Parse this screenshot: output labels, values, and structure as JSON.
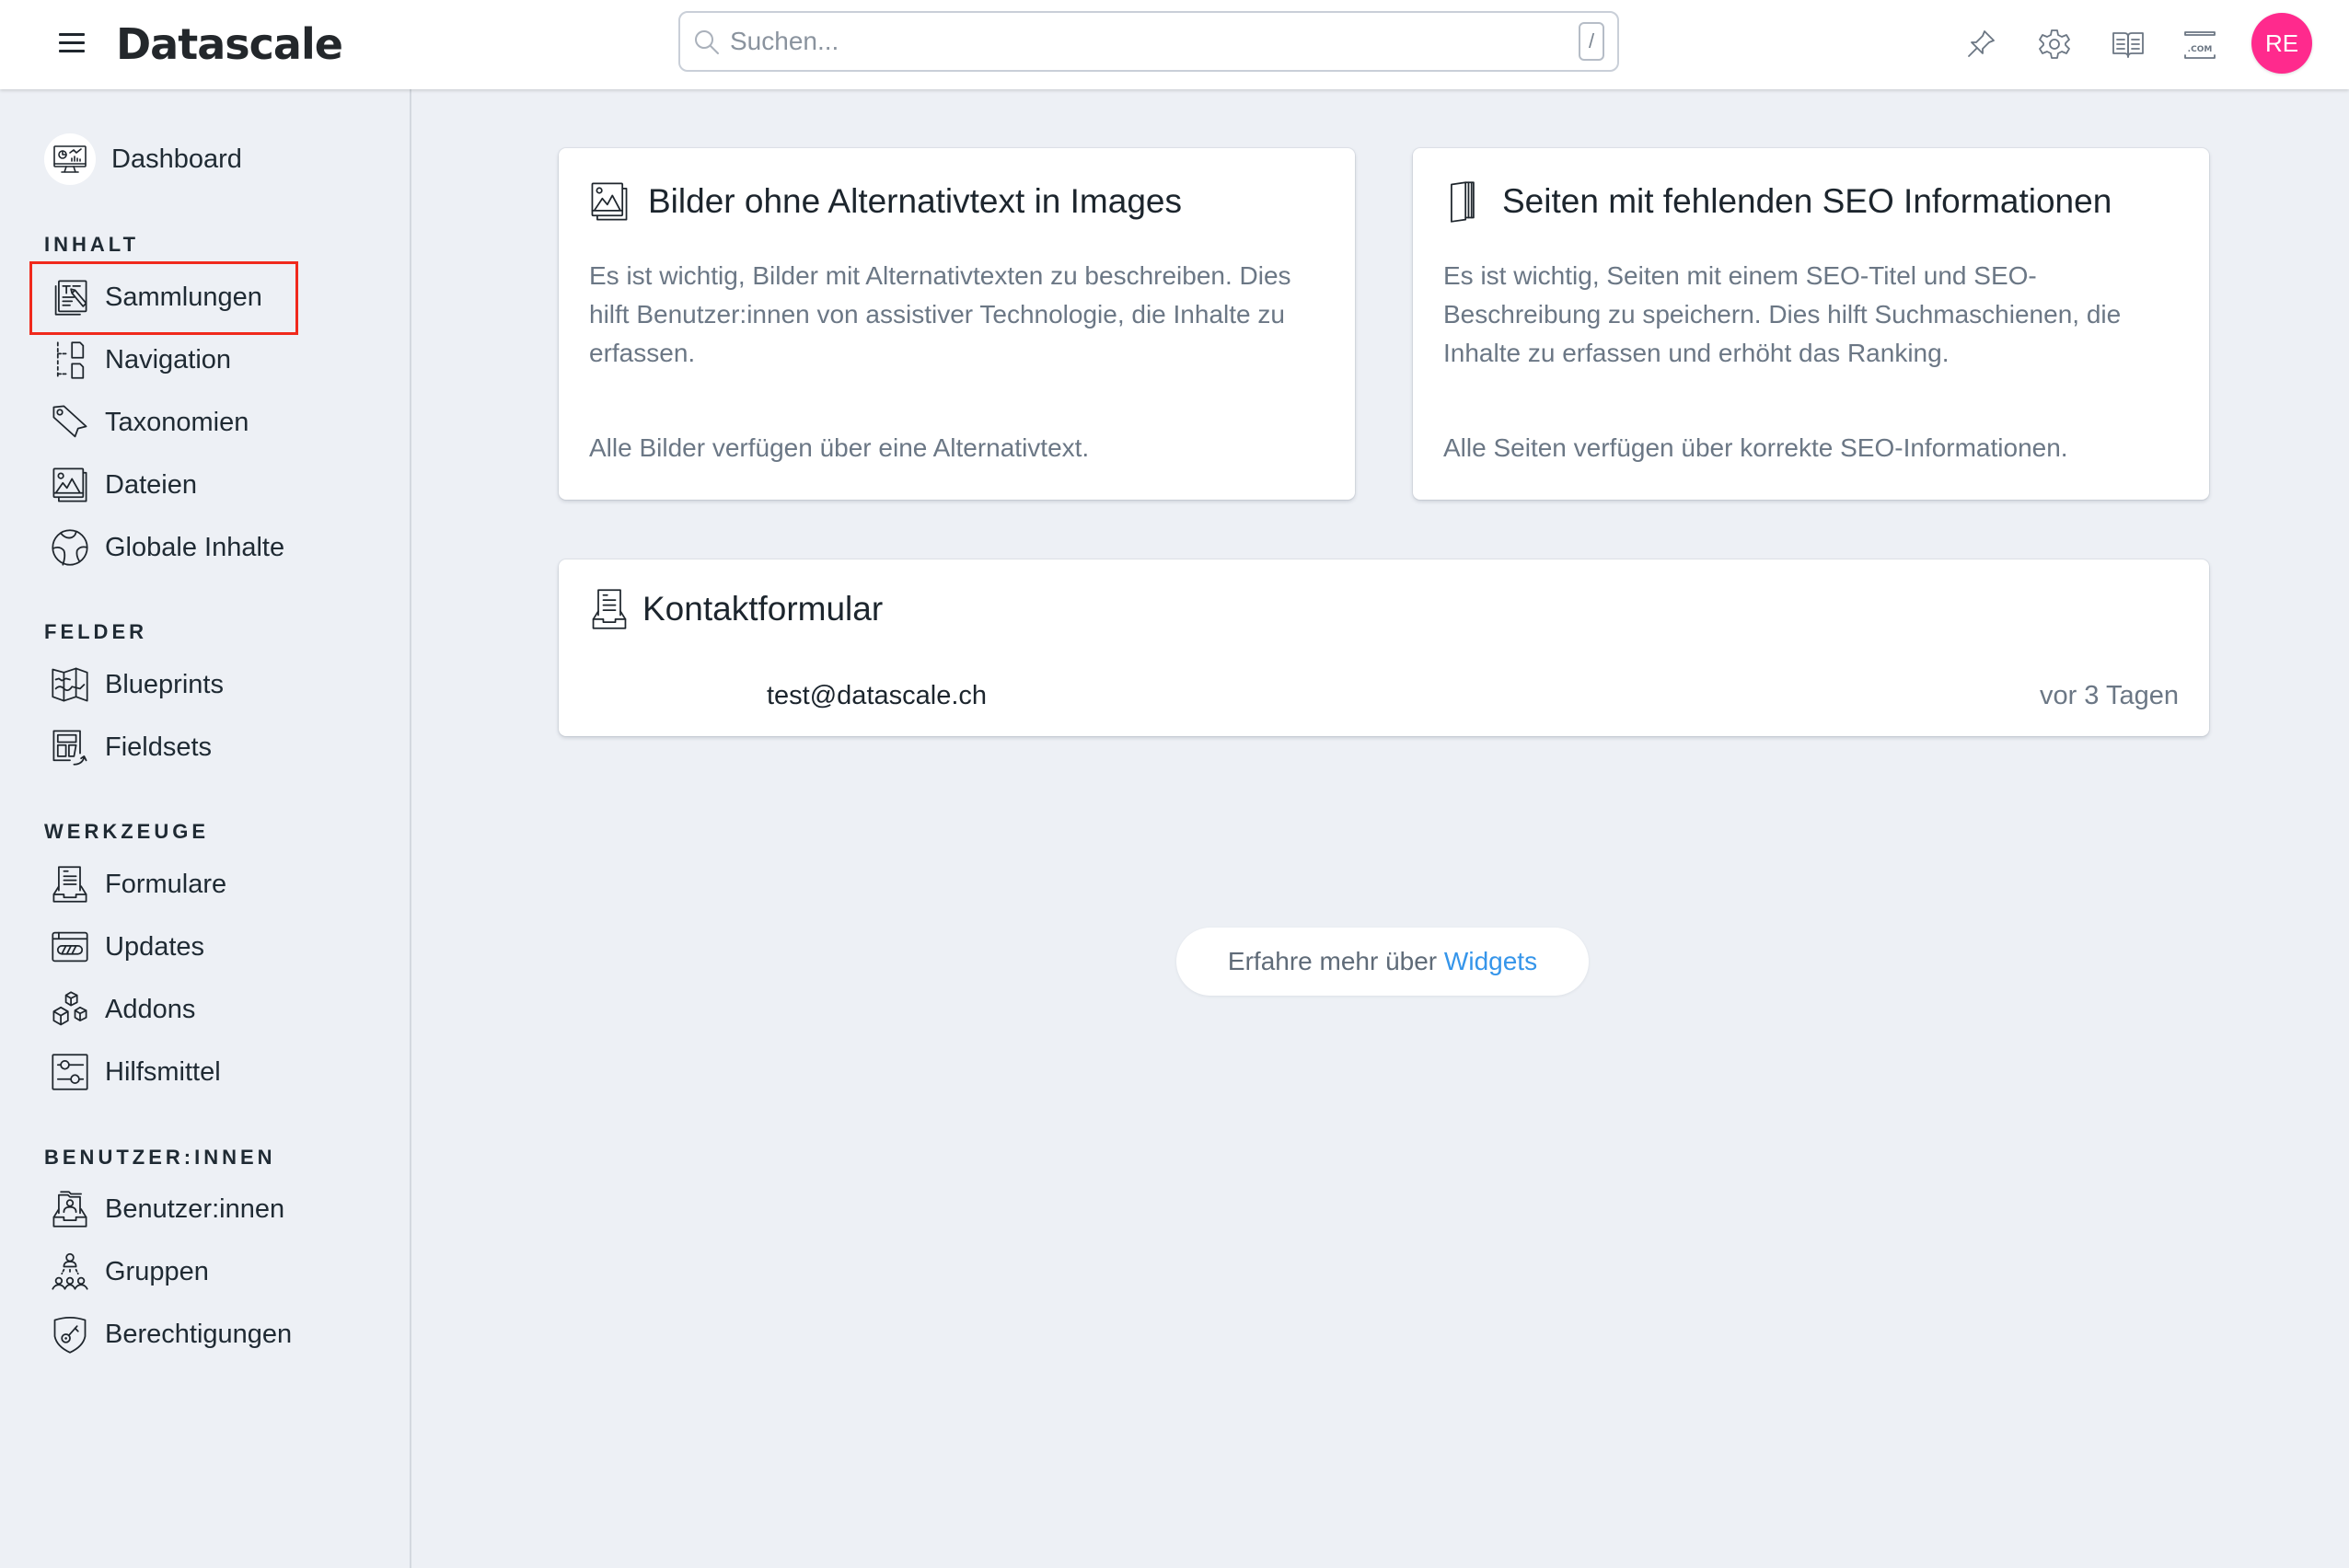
{
  "header": {
    "logo": "Datascale",
    "search": {
      "placeholder": "Suchen...",
      "value": "",
      "shortcut": "/"
    },
    "icons": [
      "pin-icon",
      "gear-icon",
      "book-icon",
      "domain-icon"
    ],
    "avatar": {
      "initials": "RE",
      "color": "#ff2a8d"
    }
  },
  "sidebar": {
    "dashboard": {
      "label": "Dashboard",
      "icon": "dashboard-monitor-icon"
    },
    "sections": [
      {
        "label": "INHALT",
        "items": [
          {
            "label": "Sammlungen",
            "icon": "collections-icon",
            "highlighted": true
          },
          {
            "label": "Navigation",
            "icon": "navigation-icon"
          },
          {
            "label": "Taxonomien",
            "icon": "tag-icon"
          },
          {
            "label": "Dateien",
            "icon": "image-icon"
          },
          {
            "label": "Globale Inhalte",
            "icon": "globe-icon"
          }
        ]
      },
      {
        "label": "FELDER",
        "items": [
          {
            "label": "Blueprints",
            "icon": "map-icon"
          },
          {
            "label": "Fieldsets",
            "icon": "fieldset-icon"
          }
        ]
      },
      {
        "label": "WERKZEUGE",
        "items": [
          {
            "label": "Formulare",
            "icon": "form-inbox-icon"
          },
          {
            "label": "Updates",
            "icon": "updates-icon"
          },
          {
            "label": "Addons",
            "icon": "boxes-icon"
          },
          {
            "label": "Hilfsmittel",
            "icon": "sliders-icon"
          }
        ]
      },
      {
        "label": "BENUTZER:INNEN",
        "items": [
          {
            "label": "Benutzer:innen",
            "icon": "user-inbox-icon"
          },
          {
            "label": "Gruppen",
            "icon": "group-icon"
          },
          {
            "label": "Berechtigungen",
            "icon": "shield-key-icon"
          }
        ]
      }
    ]
  },
  "widgets": {
    "alt_text": {
      "title": "Bilder ohne Alternativtext in Images",
      "description": "Es ist wichtig, Bilder mit Alternativtexten zu beschreiben. Dies hilft Benutzer:innen von assistiver Technologie, die Inhalte zu erfassen.",
      "status": "Alle Bilder verfügen über eine Alternativtext."
    },
    "seo": {
      "title": "Seiten mit fehlenden SEO Informationen",
      "description": "Es ist wichtig, Seiten mit einem SEO-Titel und SEO-Beschreibung zu speichern. Dies hilft Suchmaschienen, die Inhalte zu erfassen und erhöht das Ranking.",
      "status": "Alle Seiten verfügen über korrekte SEO-Informationen."
    },
    "contact_form": {
      "title": "Kontaktformular",
      "submissions": [
        {
          "email": "test@datascale.ch",
          "time": "vor 3 Tagen"
        }
      ]
    }
  },
  "footer_link": {
    "prefix": "Erfahre mehr über",
    "link": "Widgets",
    "link_color": "#3595ea"
  }
}
